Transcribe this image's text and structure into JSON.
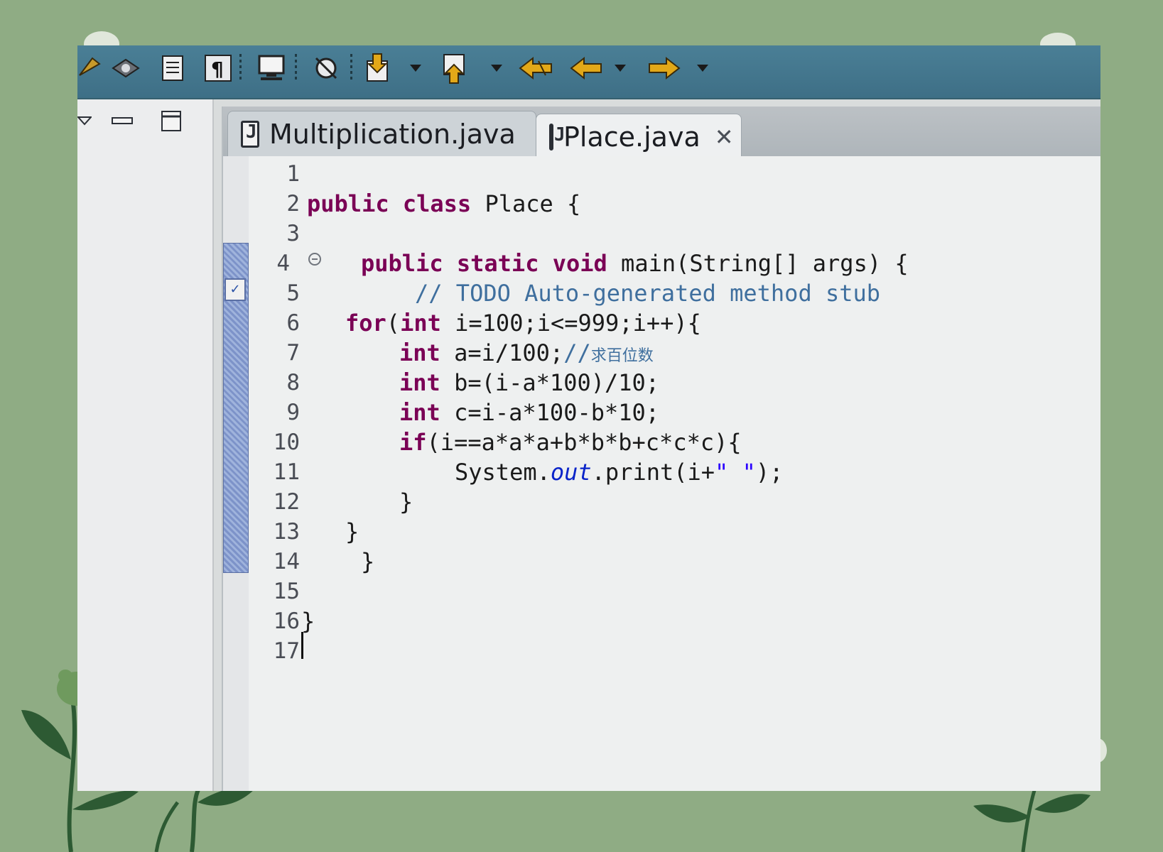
{
  "toolbar": {
    "icons": [
      "run-icon",
      "debug-icon",
      "outline-icon",
      "pilcrow-icon",
      "console-icon",
      "skip-breakpoints-icon",
      "next-annotation-icon",
      "previous-annotation-icon",
      "last-edit-location-icon",
      "back-icon",
      "forward-icon"
    ]
  },
  "left_panel": {
    "controls": [
      "view-menu-icon",
      "minimize-icon",
      "maximize-icon"
    ]
  },
  "tabs": [
    {
      "label": "Multiplication.java",
      "active": false
    },
    {
      "label": "Place.java",
      "active": true
    }
  ],
  "line_numbers": [
    "1",
    "2",
    "3",
    "4",
    "5",
    "6",
    "7",
    "8",
    "9",
    "10",
    "11",
    "12",
    "13",
    "14",
    "15",
    "16",
    "17"
  ],
  "code": {
    "l2_kw": "public class",
    "l2_rest": " Place {",
    "l4_kw": "public static void",
    "l4_rest": " main(String[] args) {",
    "l5_comment": "// TODO Auto-generated method stub",
    "l6_kw": "for",
    "l6_a": "(",
    "l6_kw2": "int",
    "l6_rest": " i=100;i<=999;i++){",
    "l7_kw": "int",
    "l7_rest": " a=i/100;",
    "l7_comment": "//",
    "l7_cjk": "求百位数",
    "l8_kw": "int",
    "l8_rest": " b=(i-a*100)/10;",
    "l9_kw": "int",
    "l9_rest": " c=i-a*100-b*10;",
    "l10_kw": "if",
    "l10_rest": "(i==a*a*a+b*b*b+c*c*c){",
    "l11_a": "System.",
    "l11_field": "out",
    "l11_b": ".print(i+",
    "l11_str": "\" \"",
    "l11_c": ");",
    "l12": "}",
    "l13": "}",
    "l14": "}",
    "l16": "}"
  },
  "colors": {
    "keyword": "#7a0055",
    "comment": "#3f6f9e",
    "field": "#0a24c9",
    "string": "#2a00ff",
    "toolbar": "#4a7f96",
    "background": "#8fac84"
  }
}
